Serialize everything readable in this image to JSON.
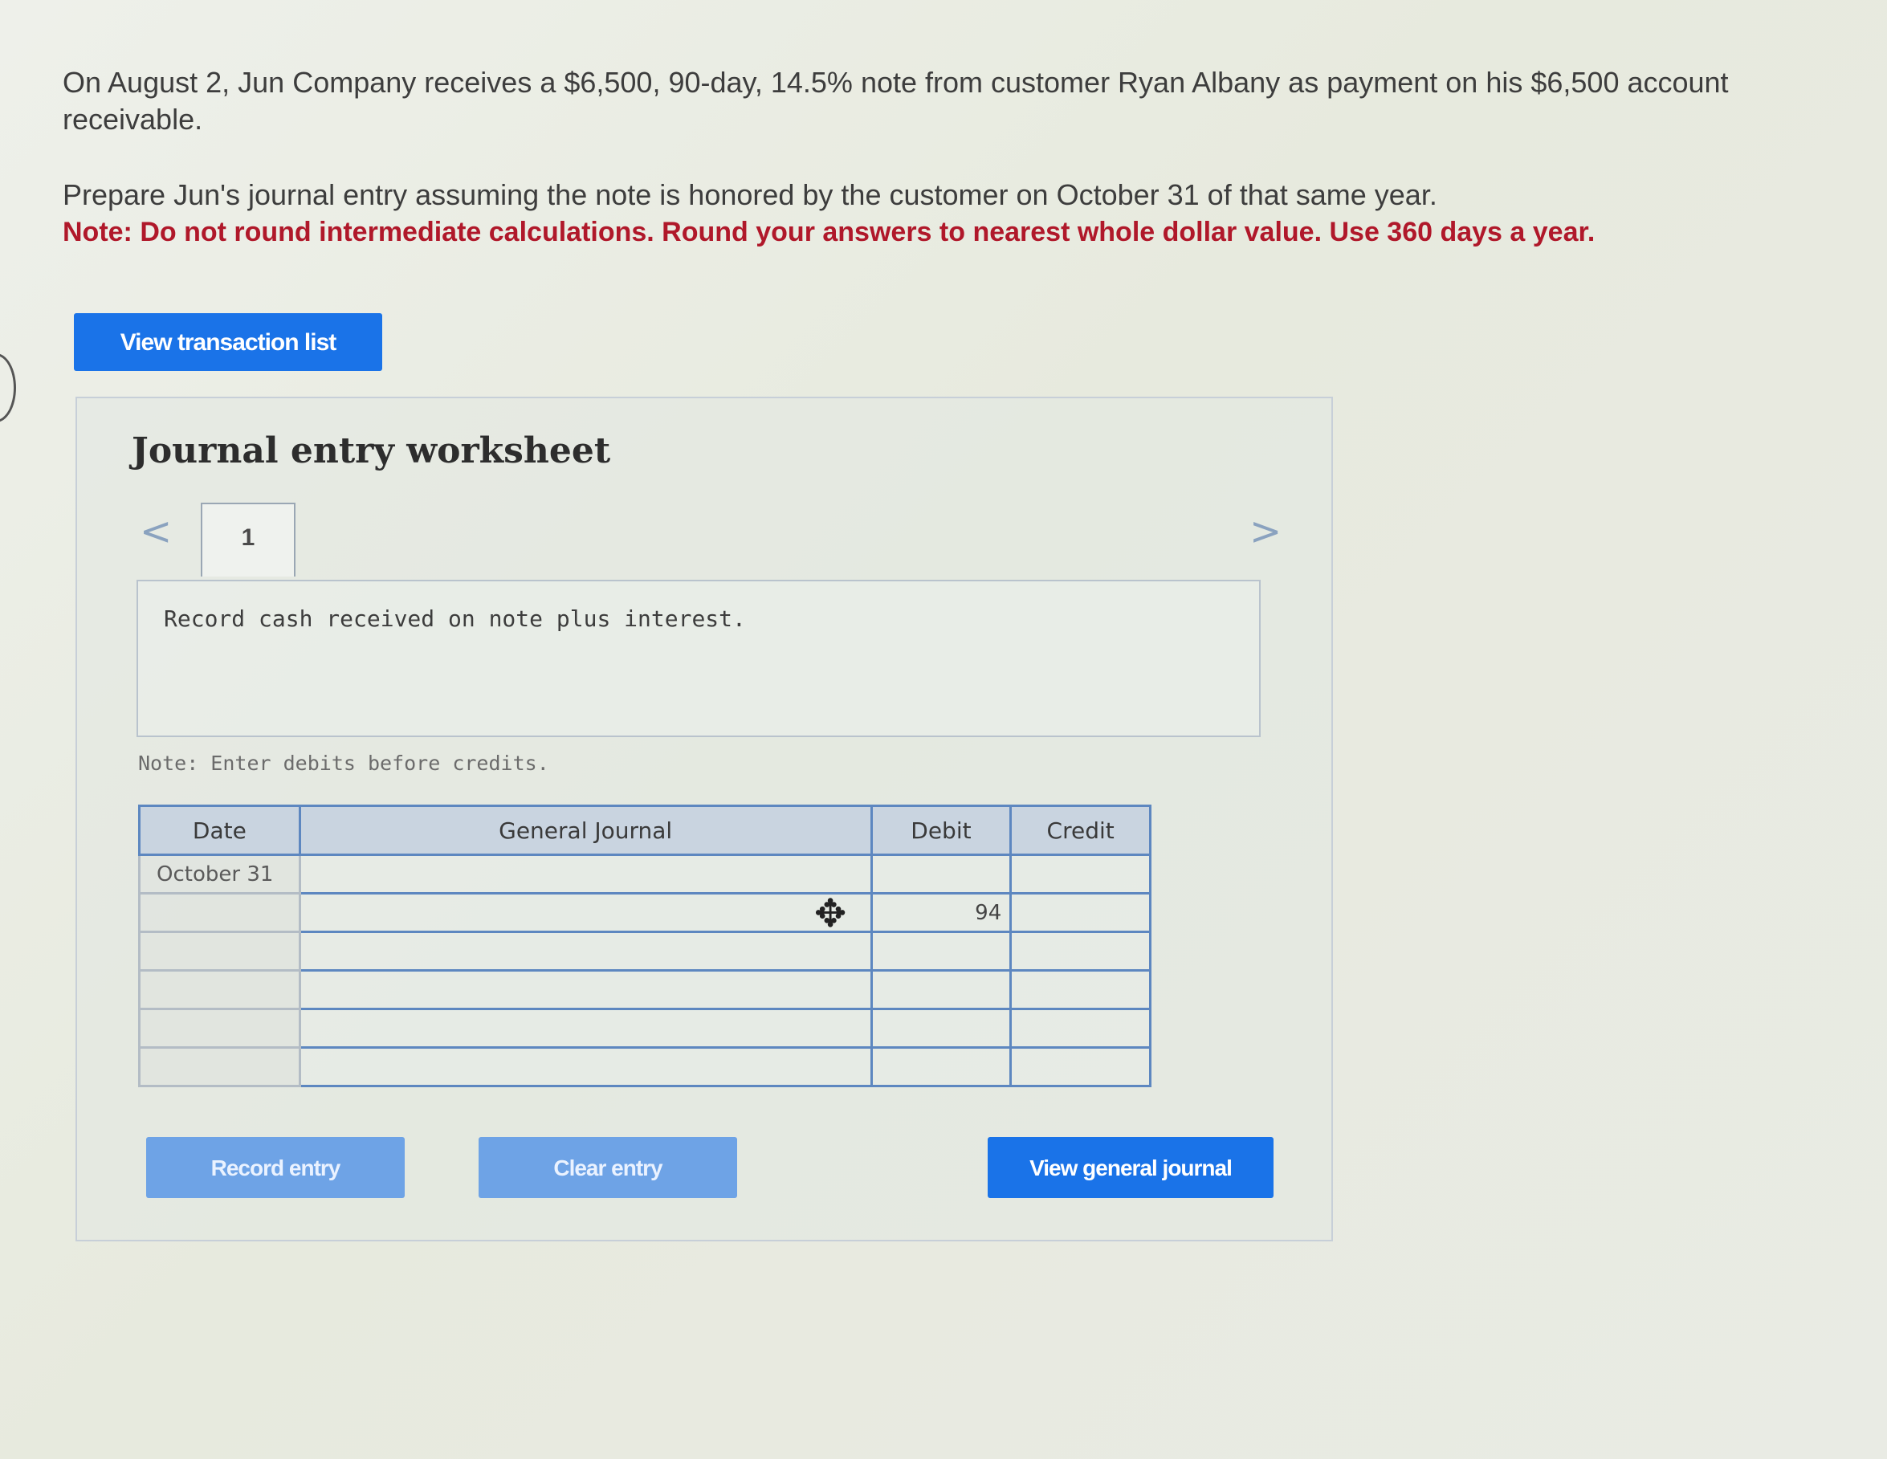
{
  "prompt": {
    "paragraph1": "On August 2, Jun Company receives a $6,500, 90-day, 14.5% note from customer Ryan Albany as payment on his $6,500 account receivable.",
    "paragraph2": "Prepare Jun's journal entry assuming the note is honored by the customer on October 31 of that same year.",
    "note": "Note: Do not round intermediate calculations. Round your answers to nearest whole dollar value. Use 360 days a year."
  },
  "buttons": {
    "view_transaction_list": "View transaction list",
    "record_entry": "Record entry",
    "clear_entry": "Clear entry",
    "view_general_journal": "View general journal"
  },
  "worksheet": {
    "title": "Journal entry worksheet",
    "prev_arrow": "<",
    "next_arrow": ">",
    "current_tab": "1",
    "instruction": "Record cash received on note plus interest.",
    "note": "Note: Enter debits before credits."
  },
  "journal": {
    "headers": {
      "date": "Date",
      "general_journal": "General Journal",
      "debit": "Debit",
      "credit": "Credit"
    },
    "rows": [
      {
        "date": "October 31",
        "account": "",
        "debit": "",
        "credit": ""
      },
      {
        "date": "",
        "account": "",
        "debit": "94",
        "credit": ""
      },
      {
        "date": "",
        "account": "",
        "debit": "",
        "credit": ""
      },
      {
        "date": "",
        "account": "",
        "debit": "",
        "credit": ""
      },
      {
        "date": "",
        "account": "",
        "debit": "",
        "credit": ""
      },
      {
        "date": "",
        "account": "",
        "debit": "",
        "credit": ""
      }
    ]
  }
}
